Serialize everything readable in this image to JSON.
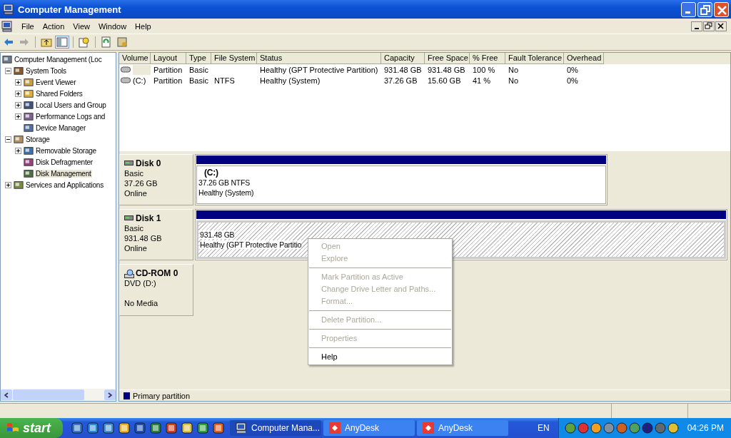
{
  "window": {
    "title": "Computer Management"
  },
  "menu": [
    "File",
    "Action",
    "View",
    "Window",
    "Help"
  ],
  "toolbar": [
    {
      "pressed": false
    },
    {
      "pressed": false
    },
    {
      "pressed": false
    },
    {
      "pressed": true
    },
    {
      "pressed": false
    },
    {
      "pressed": false
    },
    {
      "pressed": false
    }
  ],
  "tree": [
    {
      "label": "Computer Management (Loc",
      "selected": false,
      "children": [
        {
          "label": "System Tools",
          "selected": false,
          "expanded": true,
          "children": [
            {
              "label": "Event Viewer",
              "selected": false,
              "expanded": false
            },
            {
              "label": "Shared Folders",
              "selected": false,
              "expanded": false
            },
            {
              "label": "Local Users and Group",
              "selected": false,
              "expanded": false
            },
            {
              "label": "Performance Logs and",
              "selected": false,
              "expanded": false
            },
            {
              "label": "Device Manager",
              "selected": false
            }
          ]
        },
        {
          "label": "Storage",
          "selected": false,
          "expanded": true,
          "children": [
            {
              "label": "Removable Storage",
              "selected": false,
              "expanded": false
            },
            {
              "label": "Disk Defragmenter",
              "selected": false
            },
            {
              "label": "Disk Management",
              "selected": true
            }
          ]
        },
        {
          "label": "Services and Applications",
          "selected": false,
          "expanded": false
        }
      ]
    }
  ],
  "table": {
    "columns": [
      "Volume",
      "Layout",
      "Type",
      "File System",
      "Status",
      "Capacity",
      "Free Space",
      "% Free",
      "Fault Tolerance",
      "Overhead"
    ],
    "rows": [
      {
        "selected": true,
        "cells": [
          null,
          "Partition",
          "Basic",
          null,
          "Healthy (GPT Protective Partition)",
          "931.48 GB",
          "931.48 GB",
          "100 %",
          "No",
          "0%"
        ]
      },
      {
        "selected": false,
        "cells": [
          "(C:)",
          "Partition",
          "Basic",
          "NTFS",
          "Healthy (System)",
          "37.26 GB",
          "15.60 GB",
          "41 %",
          "No",
          "0%"
        ]
      }
    ]
  },
  "disks": [
    {
      "kind": "disk",
      "name": "Disk 0",
      "lines": [
        "Basic",
        "37.26 GB",
        "Online"
      ],
      "partitions": [
        {
          "label": "(C:)",
          "size": "37.26 GB NTFS",
          "status": "Healthy (System)",
          "selected": false
        }
      ]
    },
    {
      "kind": "disk",
      "name": "Disk 1",
      "lines": [
        "Basic",
        "931.48 GB",
        "Online"
      ],
      "partitions": [
        {
          "size": "931.48 GB",
          "status": "Healthy (GPT Protective Partitio",
          "selected": true
        }
      ]
    },
    {
      "kind": "cdrom",
      "name": "CD-ROM 0",
      "lines": [
        "DVD (D:)",
        "No Media"
      ]
    }
  ],
  "legend": [
    {
      "label": "Primary partition",
      "color": "#000080"
    }
  ],
  "context_menu": [
    {
      "kind": "item",
      "label": "Open",
      "disabled": true
    },
    {
      "kind": "item",
      "label": "Explore",
      "disabled": true
    },
    {
      "kind": "separator"
    },
    {
      "kind": "item",
      "label": "Mark Partition as Active",
      "disabled": true
    },
    {
      "kind": "item",
      "label": "Change Drive Letter and Paths...",
      "disabled": true
    },
    {
      "kind": "item",
      "label": "Format...",
      "disabled": true
    },
    {
      "kind": "separator"
    },
    {
      "kind": "item",
      "label": "Delete Partition...",
      "disabled": true
    },
    {
      "kind": "separator"
    },
    {
      "kind": "item",
      "label": "Properties",
      "disabled": true
    },
    {
      "kind": "separator"
    },
    {
      "kind": "item",
      "label": "Help",
      "disabled": false
    }
  ],
  "taskbar": {
    "start": "start",
    "tasks": [
      {
        "label": "Computer Mana...",
        "selected": true
      },
      {
        "label": "AnyDesk",
        "selected": false
      },
      {
        "label": "AnyDesk",
        "selected": false
      }
    ],
    "language": "EN",
    "clock": "04:26 PM"
  }
}
